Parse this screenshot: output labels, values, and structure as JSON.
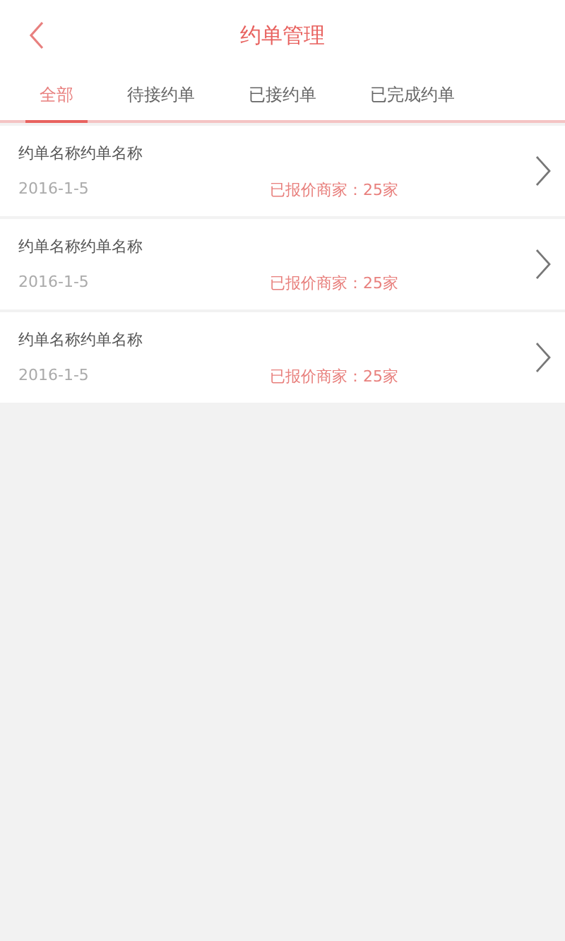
{
  "header": {
    "title": "约单管理"
  },
  "tabs": [
    {
      "label": "全部",
      "selected": true
    },
    {
      "label": "待接约单",
      "selected": false
    },
    {
      "label": "已接约单",
      "selected": false
    },
    {
      "label": "已完成约单",
      "selected": false
    }
  ],
  "orders": [
    {
      "name": "约单名称约单名称",
      "date": "2016-1-5",
      "quotes": "已报价商家：25家"
    },
    {
      "name": "约单名称约单名称",
      "date": "2016-1-5",
      "quotes": "已报价商家：25家"
    },
    {
      "name": "约单名称约单名称",
      "date": "2016-1-5",
      "quotes": "已报价商家：25家"
    }
  ]
}
